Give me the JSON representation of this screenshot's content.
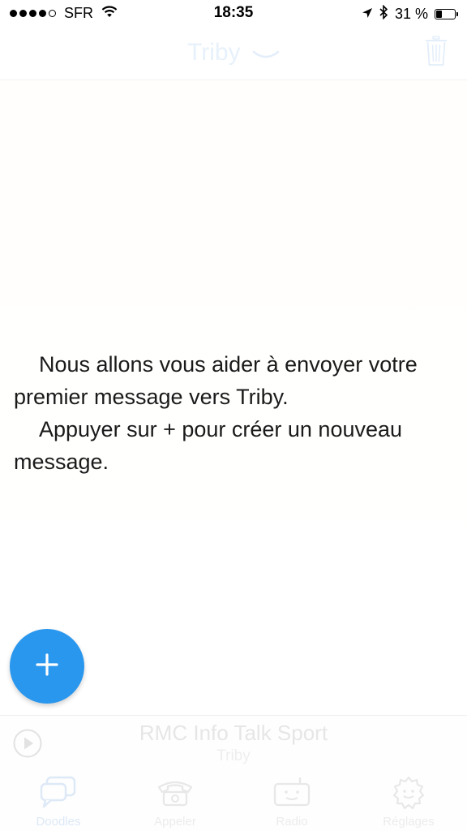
{
  "status_bar": {
    "carrier": "SFR",
    "time": "18:35",
    "battery_percent": "31 %",
    "battery_level": 0.31,
    "signal_bars_filled": 4,
    "signal_bars_total": 5
  },
  "nav": {
    "title": "Triby",
    "chevron_icon": "chevron-down-icon",
    "trash_icon": "trash-icon"
  },
  "content": {
    "line1": "Nous allons vous aider à envoyer votre premier message vers Triby.",
    "line2": "Appuyer sur + pour créer un nouveau message."
  },
  "fab": {
    "icon": "plus-icon",
    "color": "#2a97ee"
  },
  "player": {
    "station": "RMC Info Talk Sport",
    "device": "Triby"
  },
  "tabs": [
    {
      "label": "Doodles",
      "icon": "chat-bubbles-icon",
      "active": true
    },
    {
      "label": "Appeler",
      "icon": "telephone-icon",
      "active": false
    },
    {
      "label": "Radio",
      "icon": "radio-icon",
      "active": false
    },
    {
      "label": "Réglages",
      "icon": "gear-badge-icon",
      "active": false
    }
  ]
}
